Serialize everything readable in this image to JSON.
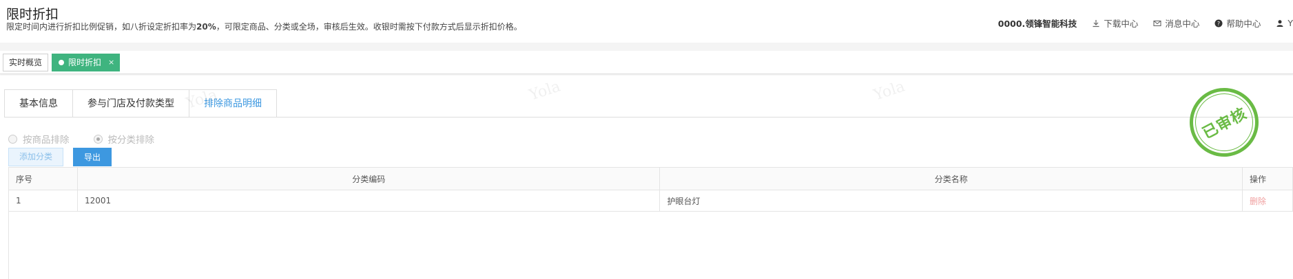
{
  "header": {
    "title": "限时折扣",
    "description_prefix": "限定时间内进行折扣比例促销，如八折设定折扣率为",
    "description_bold": "20%",
    "description_suffix": "，可限定商品、分类或全场，审核后生效。收银时需按下付款方式后显示折扣价格。",
    "company": "0000.领锋智能科技",
    "download_label": "下载中心",
    "message_label": "消息中心",
    "help_label": "帮助中心",
    "user_label": "Y"
  },
  "tabs": {
    "home_label": "实时概览",
    "active_label": "限时折扣",
    "close_glyph": "×"
  },
  "subtabs": [
    "基本信息",
    "参与门店及付款类型",
    "排除商品明细"
  ],
  "watermark_text": "Yola",
  "radios": {
    "by_product": "按商品排除",
    "by_category": "按分类排除"
  },
  "buttons": {
    "add_category": "添加分类",
    "export": "导出"
  },
  "table": {
    "headers": [
      "序号",
      "分类编码",
      "分类名称",
      "操作"
    ],
    "rows": [
      {
        "index": "1",
        "code": "12001",
        "name": "护眼台灯",
        "action": "删除"
      }
    ]
  },
  "stamp": {
    "text": "已审核",
    "color": "#6abb45"
  },
  "colors": {
    "accent_green": "#3fb47f",
    "accent_blue": "#3d98e0"
  }
}
